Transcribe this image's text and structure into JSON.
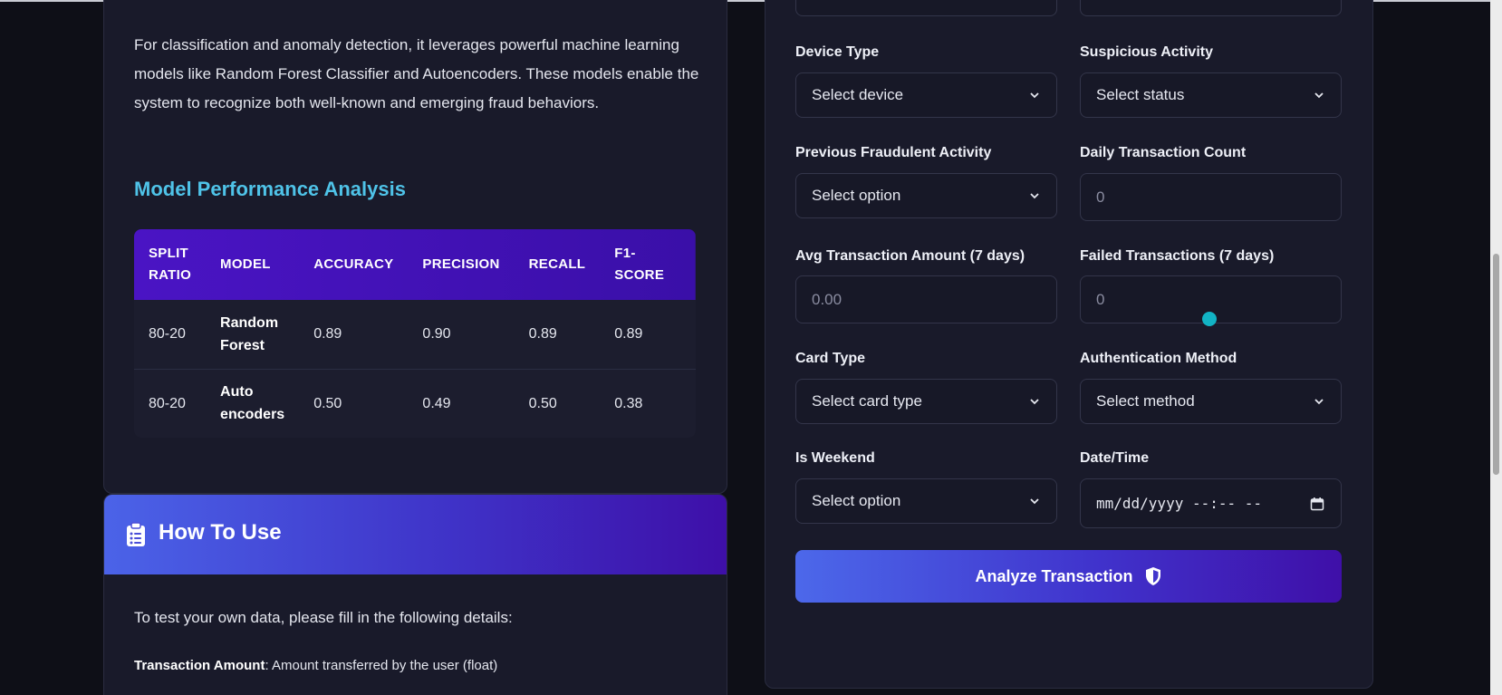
{
  "about": {
    "intro": "For classification and anomaly detection, it leverages powerful machine learning models like Random Forest Classifier and Autoencoders. These models enable the system to recognize both well-known and emerging fraud behaviors."
  },
  "performance": {
    "title": "Model Performance Analysis",
    "headers": [
      "SPLIT RATIO",
      "MODEL",
      "ACCURACY",
      "PRECISION",
      "RECALL",
      "F1-SCORE"
    ],
    "rows": [
      {
        "split": "80-20",
        "model": "Random Forest",
        "accuracy": "0.89",
        "precision": "0.90",
        "recall": "0.89",
        "f1": "0.89"
      },
      {
        "split": "80-20",
        "model": "Auto encoders",
        "accuracy": "0.50",
        "precision": "0.49",
        "recall": "0.50",
        "f1": "0.38"
      }
    ]
  },
  "how_to_use": {
    "title": "How To Use",
    "intro": "To test your own data, please fill in the following details:",
    "field_name": "Transaction Amount",
    "field_desc": ": Amount transferred by the user (float)"
  },
  "form": {
    "device_type": {
      "label": "Device Type",
      "value": "Select device"
    },
    "suspicious_activity": {
      "label": "Suspicious Activity",
      "value": "Select status"
    },
    "previous_fraud": {
      "label": "Previous Fraudulent Activity",
      "value": "Select option"
    },
    "daily_count": {
      "label": "Daily Transaction Count",
      "placeholder": "0"
    },
    "avg_amount": {
      "label": "Avg Transaction Amount (7 days)",
      "placeholder": "0.00"
    },
    "failed_tx": {
      "label": "Failed Transactions (7 days)",
      "placeholder": "0"
    },
    "card_type": {
      "label": "Card Type",
      "value": "Select card type"
    },
    "auth_method": {
      "label": "Authentication Method",
      "value": "Select method"
    },
    "is_weekend": {
      "label": "Is Weekend",
      "value": "Select option"
    },
    "datetime": {
      "label": "Date/Time",
      "placeholder": "mm/dd/yyyy --:-- --"
    },
    "submit_label": "Analyze Transaction"
  },
  "icons": {
    "how_to_use": "clipboard-list-icon",
    "submit": "shield-icon",
    "select": "chevron-down-icon",
    "date": "calendar-icon"
  },
  "colors": {
    "accent_title": "#4fc3e8",
    "table_header": "#4a14c4",
    "gradient_start": "#4b63e8",
    "gradient_end": "#3e0fa8",
    "indicator_dot": "#12b3c4"
  }
}
